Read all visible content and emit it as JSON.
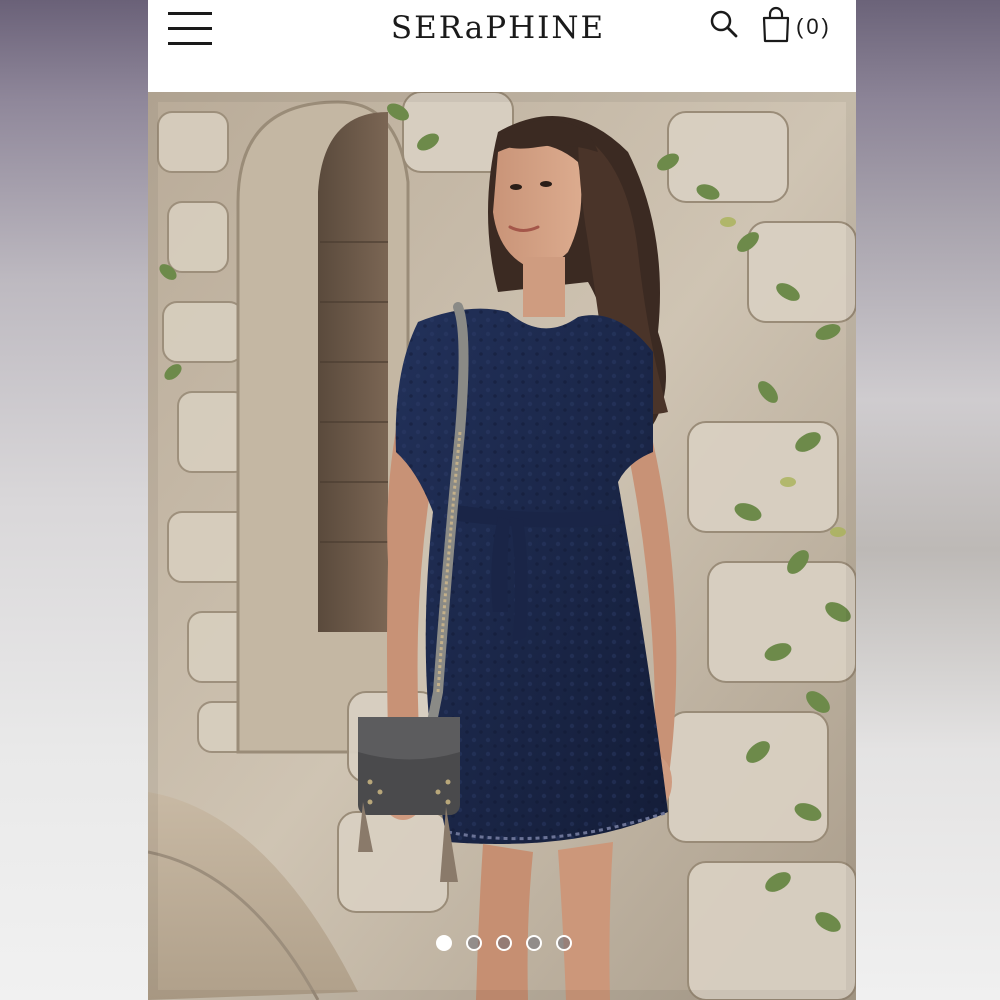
{
  "header": {
    "logo_text": "SERaPHINE",
    "cart_count": "(0)"
  },
  "icons": {
    "menu": "hamburger-menu-icon",
    "search": "search-icon",
    "cart": "shopping-bag-icon"
  },
  "carousel": {
    "total_slides": 5,
    "active_index": 0
  },
  "colors": {
    "text": "#1a1a1a",
    "dress": "#1c2a4e",
    "background": "#ffffff"
  }
}
